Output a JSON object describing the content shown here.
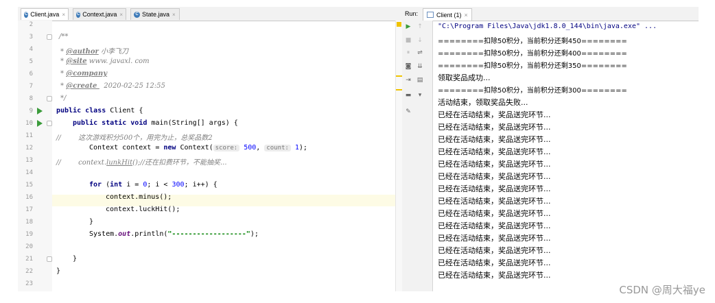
{
  "editor": {
    "tabs": [
      {
        "label": "Client.java",
        "active": true
      },
      {
        "label": "Context.java",
        "active": false
      },
      {
        "label": "State.java",
        "active": false
      }
    ],
    "line_numbers": [
      "2",
      "3",
      "4",
      "5",
      "6",
      "7",
      "8",
      "9",
      "10",
      "11",
      "12",
      "13",
      "14",
      "15",
      "16",
      "17",
      "18",
      "19",
      "20",
      "21",
      "22",
      "23"
    ],
    "code": {
      "l3": "/**",
      "l4_tag": "@author",
      "l4_val": " 小李飞刀",
      "l5_tag": "@site",
      "l5_val": " www. javaxl. com",
      "l6_tag": "@company",
      "l7_tag": "@create ",
      "l7_val": "  2020-02-25 12:55",
      "l8": "*/",
      "l9_kw": "public class ",
      "l9_rest": "Client {",
      "l10_kw": "public static void ",
      "l10_rest": "main(String[] args) {",
      "l11": "//        这次游戏积分500个，用完为止，总奖品数2",
      "l12_a": "Context context = ",
      "l12_kw": "new ",
      "l12_b": "Context(",
      "l12_hint1": "score:",
      "l12_num1": "500",
      "l12_c": ",",
      "l12_hint2": "count:",
      "l12_num2": "1",
      "l12_d": ");",
      "l13_a": "//        context.",
      "l13_b": "lunkHit",
      "l13_c": "();//还在扣费环节，不能抽奖...",
      "l15_kw": "for ",
      "l15_a": "(",
      "l15_kw2": "int ",
      "l15_b": "i = ",
      "l15_n0": "0",
      "l15_c": "; i < ",
      "l15_n1": "300",
      "l15_d": "; i++) {",
      "l16": "context.minus();",
      "l17": "context.luckHit();",
      "l18": "}",
      "l19_a": "System.",
      "l19_f": "out",
      "l19_b": ".println(",
      "l19_s": "\"------------------\"",
      "l19_c": ");",
      "l21": "}",
      "l22": "}",
      "star": "*"
    }
  },
  "run": {
    "label": "Run:",
    "tab": "Client (1)",
    "output": [
      "\"C:\\Program Files\\Java\\jdk1.8.0_144\\bin\\java.exe\" ...",
      "========扣除50积分，当前积分还剩450========",
      "========扣除50积分，当前积分还剩400========",
      "========扣除50积分，当前积分还剩350========",
      "领取奖品成功...",
      "========扣除50积分，当前积分还剩300========",
      "活动结束，领取奖品失败...",
      "已经在活动结束，奖品送完环节...",
      "已经在活动结束，奖品送完环节...",
      "已经在活动结束，奖品送完环节...",
      "已经在活动结束，奖品送完环节...",
      "已经在活动结束，奖品送完环节...",
      "已经在活动结束，奖品送完环节...",
      "已经在活动结束，奖品送完环节...",
      "已经在活动结束，奖品送完环节...",
      "已经在活动结束，奖品送完环节...",
      "已经在活动结束，奖品送完环节...",
      "已经在活动结束，奖品送完环节...",
      "已经在活动结束，奖品送完环节...",
      "已经在活动结束，奖品送完环节...",
      "已经在活动结束，奖品送完环节..."
    ]
  },
  "watermark": "CSDN @周大福ye"
}
